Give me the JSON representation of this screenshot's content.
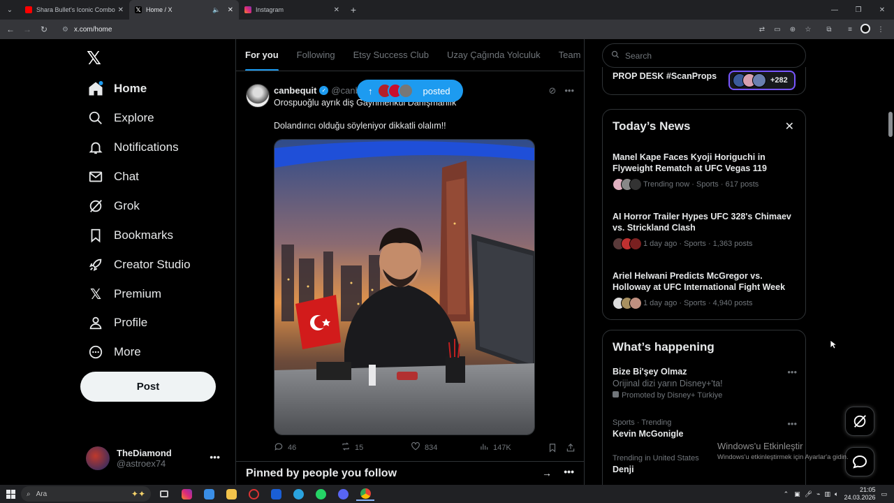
{
  "browser": {
    "tabs": [
      {
        "title": "Shara Bullet's Iconic Combo",
        "favicon_color": "#ff0000"
      },
      {
        "title": "Home / X",
        "favicon_color": "#ffffff",
        "active": true
      },
      {
        "title": "Instagram",
        "favicon_color": "#e1306c"
      }
    ],
    "url": "x.com/home"
  },
  "nav": {
    "items": [
      {
        "label": "Home",
        "icon": "home-icon",
        "active": true
      },
      {
        "label": "Explore",
        "icon": "search-icon"
      },
      {
        "label": "Notifications",
        "icon": "bell-icon"
      },
      {
        "label": "Chat",
        "icon": "mail-icon"
      },
      {
        "label": "Grok",
        "icon": "grok-icon"
      },
      {
        "label": "Bookmarks",
        "icon": "bookmark-icon"
      },
      {
        "label": "Creator Studio",
        "icon": "rocket-icon"
      },
      {
        "label": "Premium",
        "icon": "x-logo-icon"
      },
      {
        "label": "Profile",
        "icon": "person-icon"
      },
      {
        "label": "More",
        "icon": "more-circle-icon"
      }
    ],
    "post_label": "Post",
    "account": {
      "name": "TheDiamond",
      "handle": "@astroex74"
    }
  },
  "feed": {
    "tabs": [
      "For you",
      "Following",
      "Etsy Success Club",
      "Uzay Çağında Yolculuk",
      "Team M"
    ],
    "posted_pill": "posted",
    "tweet": {
      "name": "canbequit",
      "handle": "@canb",
      "line1": "Orospuoğlu ayrık diş Gayrimenkul Danışmanlık",
      "line2": "Dolandırıcı olduğu söyleniyor dikkatli olalım!!",
      "replies": "46",
      "reposts": "15",
      "likes": "834",
      "views": "147K"
    },
    "pinned_title": "Pinned by people you follow"
  },
  "sidebar": {
    "search_placeholder": "Search",
    "prop_label": "PROP DESK #ScanProps",
    "prop_count": "+282",
    "news_title": "Today’s News",
    "news": [
      {
        "headline": "Manel Kape Faces Kyoji Horiguchi in Flyweight Rematch at UFC Vegas 119",
        "meta": "Trending now · Sports · 617 posts"
      },
      {
        "headline": "AI Horror Trailer Hypes UFC 328's Chimaev vs. Strickland Clash",
        "meta": "1 day ago · Sports · 1,363 posts"
      },
      {
        "headline": "Ariel Helwani Predicts McGregor vs. Holloway at UFC International Fight Week",
        "meta": "1 day ago · Sports · 4,940 posts"
      }
    ],
    "happening_title": "What’s happening",
    "happening": [
      {
        "title": "Bize Bi'şey Olmaz",
        "subtitle": "Orijinal dizi yarın Disney+'ta!",
        "promo": "Promoted by Disney+ Türkiye"
      },
      {
        "category": "Sports · Trending",
        "title": "Kevin McGonigle"
      },
      {
        "category": "Trending in United States",
        "title": "Denji"
      }
    ]
  },
  "watermark": {
    "line1": "Windows'u Etkinleştir",
    "line2": "Windows'u etkinleştirmek için Ayarlar'a gidin."
  },
  "taskbar": {
    "search_label": "Ara",
    "time": "21:05",
    "date": "24.03.2026"
  }
}
